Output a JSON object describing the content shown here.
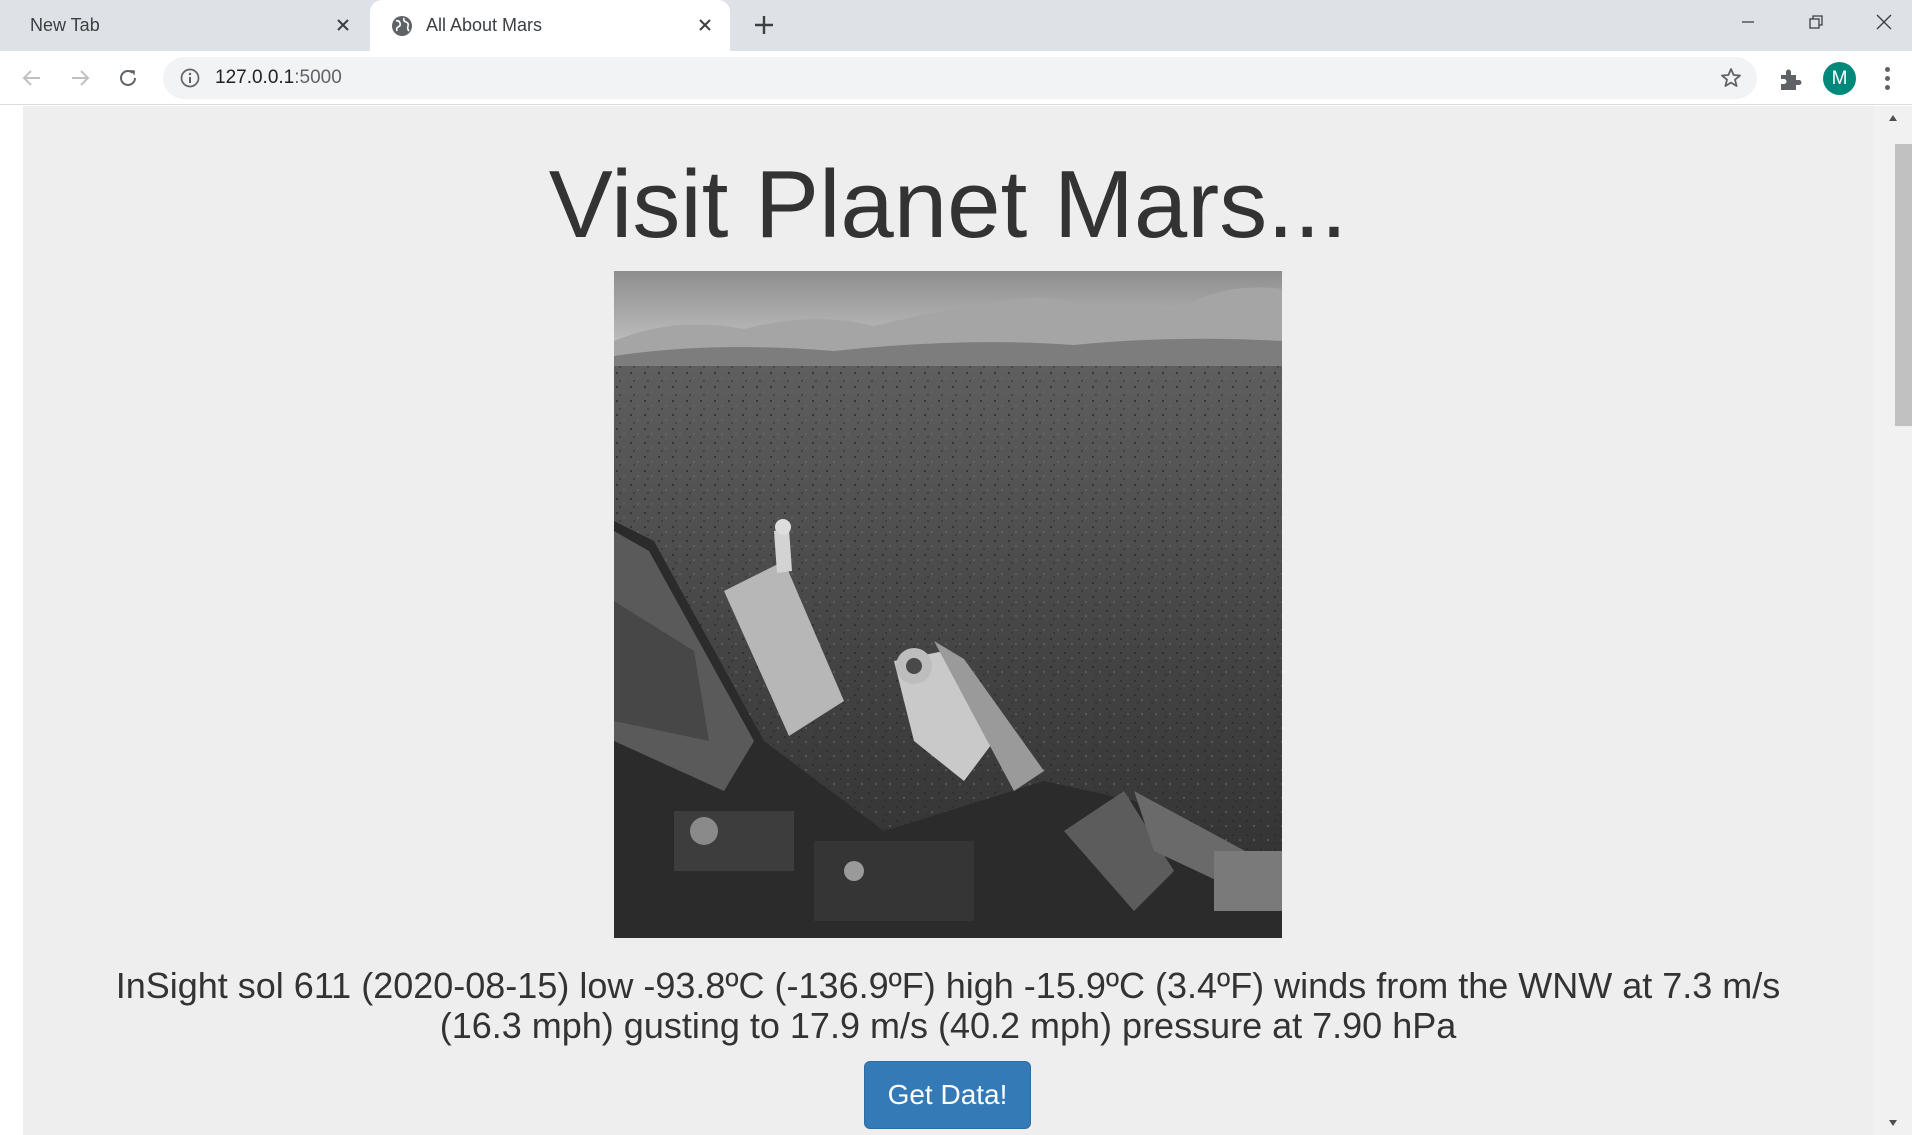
{
  "browser": {
    "tabs": [
      {
        "title": "New Tab",
        "active": false
      },
      {
        "title": "All About Mars",
        "active": true
      }
    ],
    "url_host": "127.0.0.1",
    "url_port": ":5000",
    "profile_initial": "M",
    "accent_colors": {
      "profile": "#00897b",
      "button": "#337ab7"
    }
  },
  "page": {
    "heading": "Visit Planet Mars...",
    "weather_text": "InSight sol 611 (2020-08-15) low -93.8ºC (-136.9ºF) high -15.9ºC (3.4ºF) winds from the WNW at 7.3 m/s (16.3 mph) gusting to 17.9 m/s (40.2 mph) pressure at 7.90 hPa",
    "button_label": "Get Data!"
  }
}
